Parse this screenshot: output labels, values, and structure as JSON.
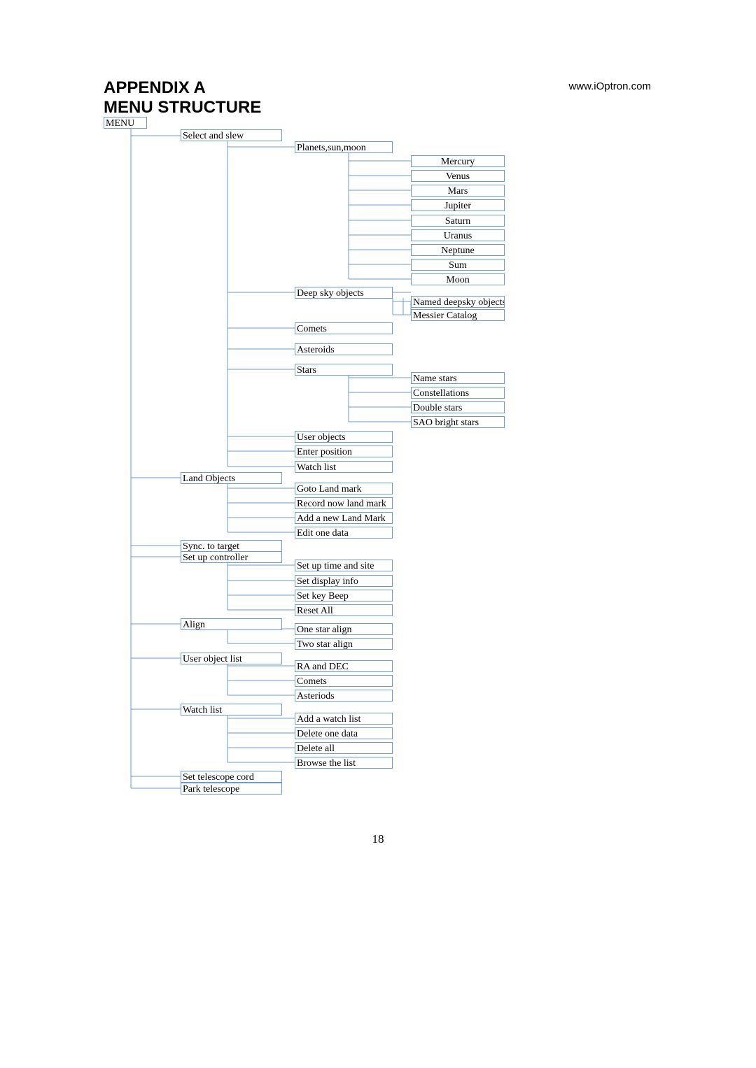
{
  "header": {
    "title_line1": "APPENDIX A",
    "title_line2": "MENU STRUCTURE",
    "url": "www.iOptron.com"
  },
  "page_number": "18",
  "menu": {
    "root": "MENU",
    "level1": [
      "Select and slew",
      "Land Objects",
      "Sync. to target",
      "Set  up controller",
      "Align",
      "User object list",
      "Watch list",
      "Set telescope cord",
      "Park telescope"
    ],
    "select_and_slew": {
      "items": [
        "Planets,sun,moon",
        "Deep sky objects",
        "Comets",
        "Asteroids",
        "Stars",
        "User objects",
        "Enter position",
        "Watch list"
      ],
      "planets": [
        "Mercury",
        "Venus",
        "Mars",
        "Jupiter",
        "Saturn",
        "Uranus",
        "Neptune",
        "Sum",
        "Moon"
      ],
      "deepsky": [
        "Named deepsky objects",
        "Messier Catalog"
      ],
      "stars": [
        "Name stars",
        "Constellations",
        "Double stars",
        "SAO bright stars"
      ]
    },
    "land_objects": [
      "Goto Land mark",
      "Record now land mark",
      "Add a new Land Mark",
      "Edit one data"
    ],
    "set_up_controller": [
      "Set up time and site",
      "Set display info",
      "Set key Beep",
      "Reset All"
    ],
    "align": [
      "One star align",
      "Two star align"
    ],
    "user_object_list": [
      "RA and DEC",
      "Comets",
      "Asteriods"
    ],
    "watch_list": [
      "Add a watch list",
      "Delete one data",
      "Delete all",
      "Browse the list"
    ]
  }
}
